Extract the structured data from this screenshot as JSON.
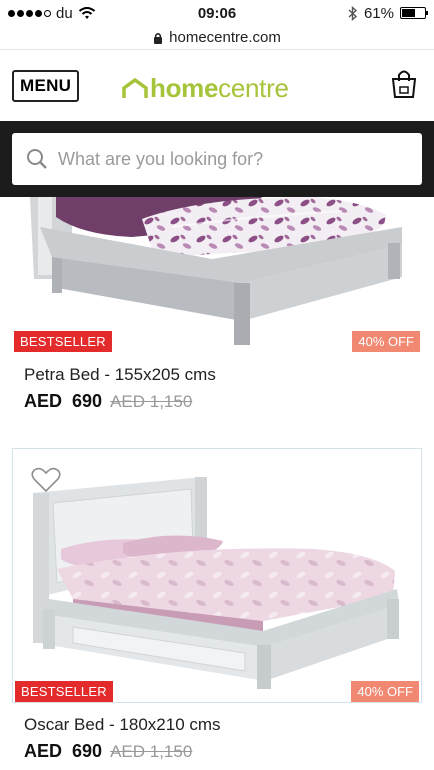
{
  "status_bar": {
    "carrier": "du",
    "time": "09:06",
    "battery": "61%",
    "battery_level": 0.61
  },
  "browser": {
    "url": "homecentre.com"
  },
  "header": {
    "menu_label": "MENU",
    "logo_home": "home",
    "logo_centre": "centre",
    "brand_color": "#a6c43a"
  },
  "search": {
    "placeholder": "What are you looking for?"
  },
  "products": [
    {
      "name": "Petra Bed - 155x205 cms",
      "badge": "BESTSELLER",
      "discount": "40% OFF",
      "currency": "AED",
      "price": "690",
      "old_price": "AED  1,150"
    },
    {
      "name": "Oscar Bed - 180x210 cms",
      "badge": "BESTSELLER",
      "discount": "40% OFF",
      "currency": "AED",
      "price": "690",
      "old_price": "AED  1,150"
    }
  ],
  "colors": {
    "bestseller_badge": "#e32b2b",
    "discount_badge": "#f08872",
    "search_band": "#1c1c1c"
  }
}
